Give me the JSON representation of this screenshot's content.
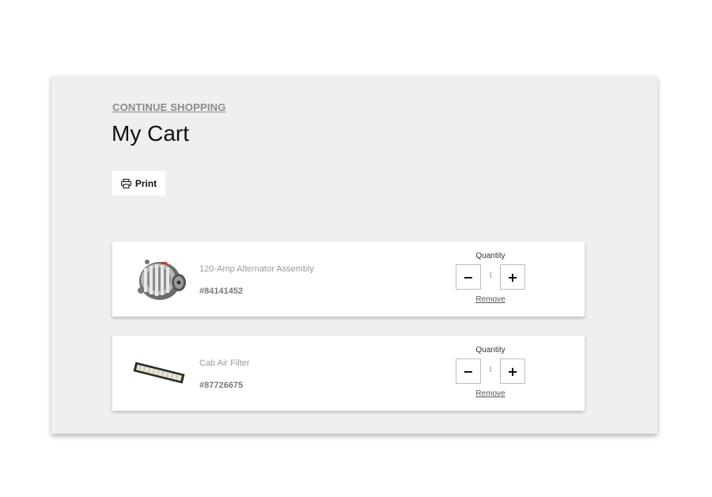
{
  "header": {
    "continue_label": "CONTINUE SHOPPING",
    "title": "My Cart",
    "print_label": "Print"
  },
  "cart": {
    "quantity_label": "Quantity",
    "remove_label": "Remove",
    "items": [
      {
        "name": "120-Amp Alternator Assembly",
        "sku": "#84141452",
        "quantity": "1",
        "image_icon": "alternator-image"
      },
      {
        "name": "Cab Air Filter",
        "sku": "#87726675",
        "quantity": "1",
        "image_icon": "cab-air-filter-image"
      }
    ]
  },
  "icons": {
    "print": "printer-icon",
    "minus": "minus-icon",
    "plus": "plus-icon"
  },
  "colors": {
    "panel_bg": "#efefef",
    "card_bg": "#ffffff",
    "link_gray": "#8a8a8a"
  }
}
